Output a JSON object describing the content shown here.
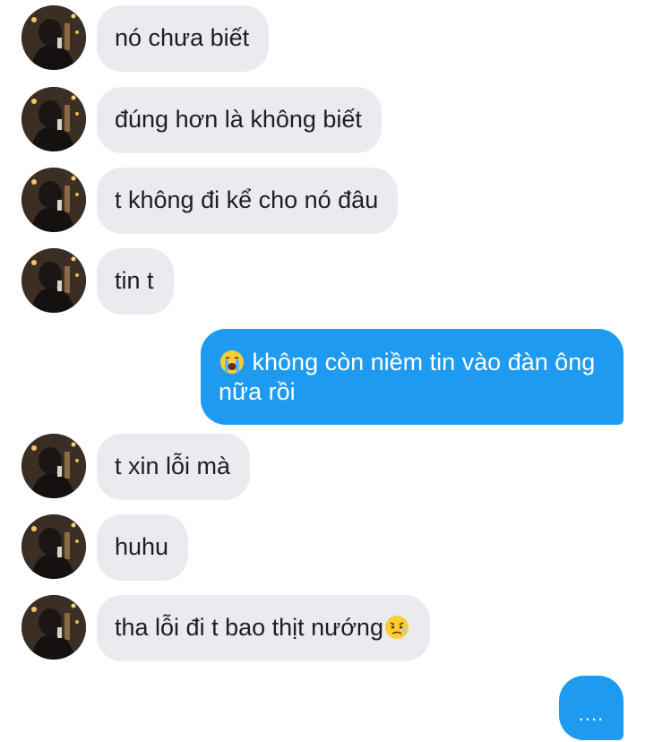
{
  "messages": [
    {
      "text": "nó chưa biết"
    },
    {
      "text": "đúng hơn là không biết"
    },
    {
      "text": "t không đi kể cho nó đâu"
    },
    {
      "text": "tin t"
    },
    {
      "text": "không còn niềm tin vào đàn ông nữa rồi",
      "emoji": "loudly-crying-face-icon"
    },
    {
      "text": "t xin lỗi mà"
    },
    {
      "text": "huhu"
    },
    {
      "text": "tha lỗi đi t bao thịt nướng",
      "emoji": "disappointed-relieved-face-icon"
    },
    {
      "text": "...."
    }
  ],
  "colors": {
    "incoming_bubble": "#e9ebee",
    "outgoing_bubble": "#1e9bf0",
    "incoming_text": "#1c1e21",
    "outgoing_text": "#ffffff"
  }
}
